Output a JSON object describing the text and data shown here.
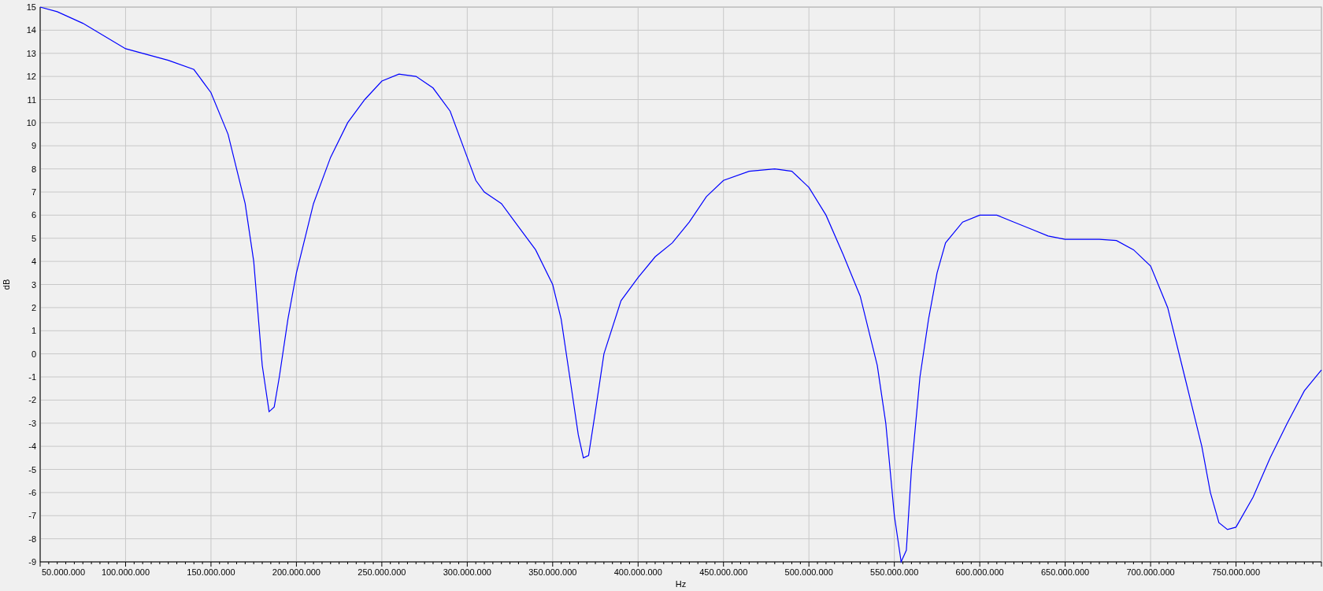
{
  "chart": {
    "chart_data": {
      "type": "line",
      "grid": true,
      "xlabel": "Hz",
      "ylabel": "dB",
      "xlim": [
        50000000,
        800000000
      ],
      "ylim": [
        -9,
        15
      ],
      "xticks": [
        {
          "value": 50000000,
          "label": "50.000.000"
        },
        {
          "value": 100000000,
          "label": "100.000.000"
        },
        {
          "value": 150000000,
          "label": "150.000.000"
        },
        {
          "value": 200000000,
          "label": "200.000.000"
        },
        {
          "value": 250000000,
          "label": "250.000.000"
        },
        {
          "value": 300000000,
          "label": "300.000.000"
        },
        {
          "value": 350000000,
          "label": "350.000.000"
        },
        {
          "value": 400000000,
          "label": "400.000.000"
        },
        {
          "value": 450000000,
          "label": "450.000.000"
        },
        {
          "value": 500000000,
          "label": "500.000.000"
        },
        {
          "value": 550000000,
          "label": "550.000.000"
        },
        {
          "value": 600000000,
          "label": "600.000.000"
        },
        {
          "value": 650000000,
          "label": "650.000.000"
        },
        {
          "value": 700000000,
          "label": "700.000.000"
        },
        {
          "value": 750000000,
          "label": "750.000.000"
        }
      ],
      "yticks": [
        15,
        14,
        13,
        12,
        11,
        10,
        9,
        8,
        7,
        6,
        5,
        4,
        3,
        2,
        1,
        0,
        -1,
        -2,
        -3,
        -4,
        -5,
        -6,
        -7,
        -8,
        -9
      ],
      "x": [
        50000000,
        60000000,
        75000000,
        100000000,
        125000000,
        140000000,
        150000000,
        160000000,
        170000000,
        175000000,
        180000000,
        184000000,
        187000000,
        190000000,
        195000000,
        200000000,
        210000000,
        220000000,
        230000000,
        240000000,
        250000000,
        260000000,
        270000000,
        280000000,
        290000000,
        300000000,
        305000000,
        310000000,
        320000000,
        330000000,
        340000000,
        350000000,
        355000000,
        360000000,
        365000000,
        368000000,
        371000000,
        375000000,
        380000000,
        390000000,
        400000000,
        410000000,
        420000000,
        430000000,
        440000000,
        450000000,
        465000000,
        480000000,
        490000000,
        500000000,
        510000000,
        520000000,
        530000000,
        540000000,
        545000000,
        550000000,
        554000000,
        557000000,
        560000000,
        565000000,
        570000000,
        575000000,
        580000000,
        590000000,
        600000000,
        610000000,
        620000000,
        630000000,
        640000000,
        650000000,
        670000000,
        680000000,
        690000000,
        700000000,
        710000000,
        720000000,
        730000000,
        735000000,
        740000000,
        745000000,
        750000000,
        760000000,
        770000000,
        780000000,
        790000000,
        800000000
      ],
      "series": [
        {
          "color": "#0000ff",
          "values": [
            15,
            14.8,
            14.3,
            13.2,
            12.7,
            12.3,
            11.3,
            9.5,
            6.5,
            4,
            -0.5,
            -2.5,
            -2.3,
            -1,
            1.5,
            3.5,
            6.5,
            8.5,
            10,
            11,
            11.8,
            12.1,
            12,
            11.5,
            10.5,
            8.5,
            7.5,
            7,
            6.5,
            5.5,
            4.5,
            3,
            1.5,
            -1,
            -3.5,
            -4.5,
            -4.4,
            -2.5,
            0,
            2.3,
            3.3,
            4.2,
            4.8,
            5.7,
            6.8,
            7.5,
            7.9,
            8,
            7.9,
            7.2,
            6,
            4.3,
            2.5,
            -0.5,
            -3,
            -7,
            -9,
            -8.5,
            -5,
            -1,
            1.5,
            3.5,
            4.8,
            5.7,
            6,
            6,
            5.7,
            5.4,
            5.1,
            4.95,
            4.95,
            4.9,
            4.5,
            3.8,
            2,
            -1,
            -4,
            -6,
            -7.3,
            -7.6,
            -7.5,
            -6.2,
            -4.5,
            -3,
            -1.6,
            -0.7
          ]
        }
      ]
    }
  }
}
